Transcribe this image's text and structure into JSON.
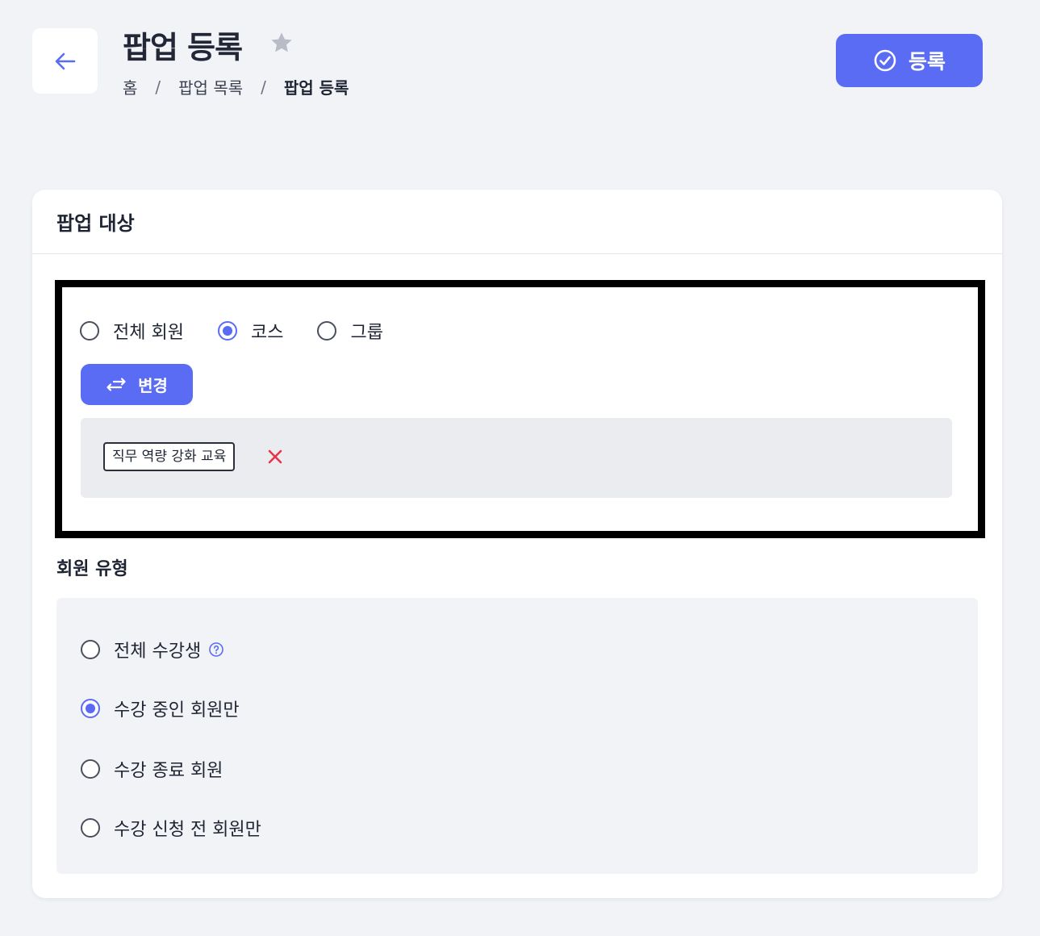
{
  "header": {
    "title": "팝업 등록",
    "breadcrumb": [
      "홈",
      "팝업 목록",
      "팝업 등록"
    ],
    "separator": "/",
    "register_label": "등록"
  },
  "colors": {
    "accent": "#5a6cf4",
    "remove": "#e8334a",
    "background": "#f1f3f7"
  },
  "target": {
    "section_title": "팝업 대상",
    "options": [
      {
        "label": "전체 회원",
        "checked": false
      },
      {
        "label": "코스",
        "checked": true
      },
      {
        "label": "그룹",
        "checked": false
      }
    ],
    "change_label": "변경",
    "selected_tags": [
      "직무 역량 강화 교육"
    ]
  },
  "member_type": {
    "title": "회원 유형",
    "options": [
      {
        "label": "전체 수강생",
        "checked": false,
        "help": true
      },
      {
        "label": "수강 중인 회원만",
        "checked": true
      },
      {
        "label": "수강 종료 회원",
        "checked": false
      },
      {
        "label": "수강 신청 전 회원만",
        "checked": false
      }
    ]
  }
}
